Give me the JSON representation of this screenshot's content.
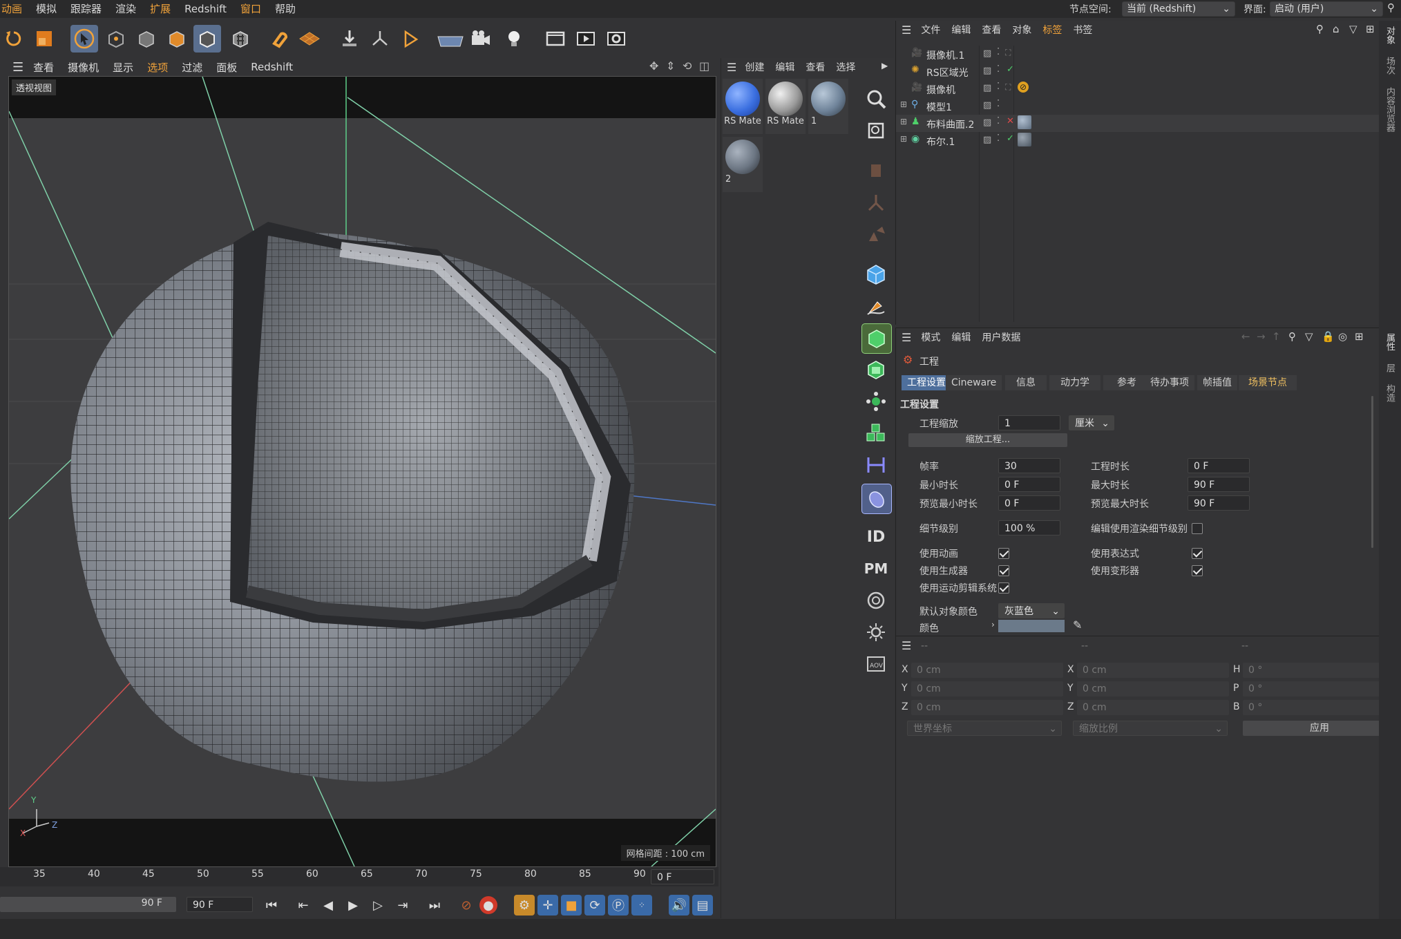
{
  "menu": {
    "items": [
      "动画",
      "模拟",
      "跟踪器",
      "渲染",
      "扩展",
      "Redshift",
      "窗口",
      "帮助"
    ],
    "node_space_label": "节点空间:",
    "node_space_value": "当前 (Redshift)",
    "interface_label": "界面:",
    "interface_value": "启动 (用户)"
  },
  "viewport": {
    "menu": [
      "查看",
      "摄像机",
      "显示",
      "选项",
      "过滤",
      "面板",
      "Redshift"
    ],
    "title": "透视视图",
    "grid_info": "网格间距 : 100 cm",
    "axis_y": "Y",
    "axis_x": "X",
    "axis_z": "Z"
  },
  "timeline": {
    "ticks": [
      "35",
      "40",
      "45",
      "50",
      "55",
      "60",
      "65",
      "70",
      "75",
      "80",
      "85",
      "90"
    ],
    "current_frame": "0 F",
    "range_end": "90 F",
    "range_end2": "90 F"
  },
  "materials": {
    "menu": [
      "创建",
      "编辑",
      "查看",
      "选择"
    ],
    "items": [
      {
        "label": "RS Mate",
        "color": "#3b6fe0"
      },
      {
        "label": "RS Mate",
        "color": "#9a9a9a"
      },
      {
        "label": "1",
        "color": "#6f8399"
      },
      {
        "label": "2",
        "color": "#6c7683"
      }
    ]
  },
  "object_manager": {
    "menu": [
      "文件",
      "编辑",
      "查看",
      "对象",
      "标签",
      "书签"
    ],
    "objects": [
      {
        "name": "摄像机.1",
        "icon": "camera-icon"
      },
      {
        "name": "RS区域光",
        "icon": "light-icon"
      },
      {
        "name": "摄像机",
        "icon": "camera-icon"
      },
      {
        "name": "模型1",
        "icon": "null-icon"
      },
      {
        "name": "布料曲面.2",
        "icon": "cloth-icon"
      },
      {
        "name": "布尔.1",
        "icon": "boole-icon"
      }
    ]
  },
  "attributes": {
    "menu": [
      "模式",
      "编辑",
      "用户数据"
    ],
    "section": "工程",
    "tabs": [
      "工程设置",
      "Cineware",
      "信息",
      "动力学",
      "参考",
      "待办事项",
      "帧插值",
      "场景节点"
    ],
    "group_title": "工程设置",
    "project_scale_label": "工程缩放",
    "project_scale_value": "1",
    "project_scale_unit": "厘米",
    "scale_button": "缩放工程...",
    "fps_label": "帧率",
    "fps_value": "30",
    "project_time_label": "工程时长",
    "project_time_value": "0 F",
    "min_time_label": "最小时长",
    "min_time_value": "0 F",
    "max_time_label": "最大时长",
    "max_time_value": "90 F",
    "preview_min_label": "预览最小时长",
    "preview_min_value": "0 F",
    "preview_max_label": "预览最大时长",
    "preview_max_value": "90 F",
    "lod_label": "细节级别",
    "lod_value": "100 %",
    "render_lod_label": "编辑使用渲染细节级别",
    "use_anim_label": "使用动画",
    "use_expr_label": "使用表达式",
    "use_gen_label": "使用生成器",
    "use_deform_label": "使用变形器",
    "use_motion_label": "使用运动剪辑系统",
    "default_color_label": "默认对象颜色",
    "default_color_value": "灰蓝色",
    "color_label": "颜色"
  },
  "coords": {
    "header": [
      "--",
      "--",
      "--"
    ],
    "rows": [
      {
        "a": "X",
        "av": "0 cm",
        "b": "X",
        "bv": "0 cm",
        "c": "H",
        "cv": "0 °"
      },
      {
        "a": "Y",
        "av": "0 cm",
        "b": "Y",
        "bv": "0 cm",
        "c": "P",
        "cv": "0 °"
      },
      {
        "a": "Z",
        "av": "0 cm",
        "b": "Z",
        "bv": "0 cm",
        "c": "B",
        "cv": "0 °"
      }
    ],
    "world_coords": "世界坐标",
    "scale_ratio": "缩放比例",
    "apply": "应用"
  },
  "right_strip": [
    "对象",
    "场次",
    "内容浏览器",
    "属性",
    "层",
    "构造"
  ],
  "colors": {
    "accent": "#f0a23a",
    "active_tab": "#4e6f9c",
    "bg": "#333335"
  }
}
